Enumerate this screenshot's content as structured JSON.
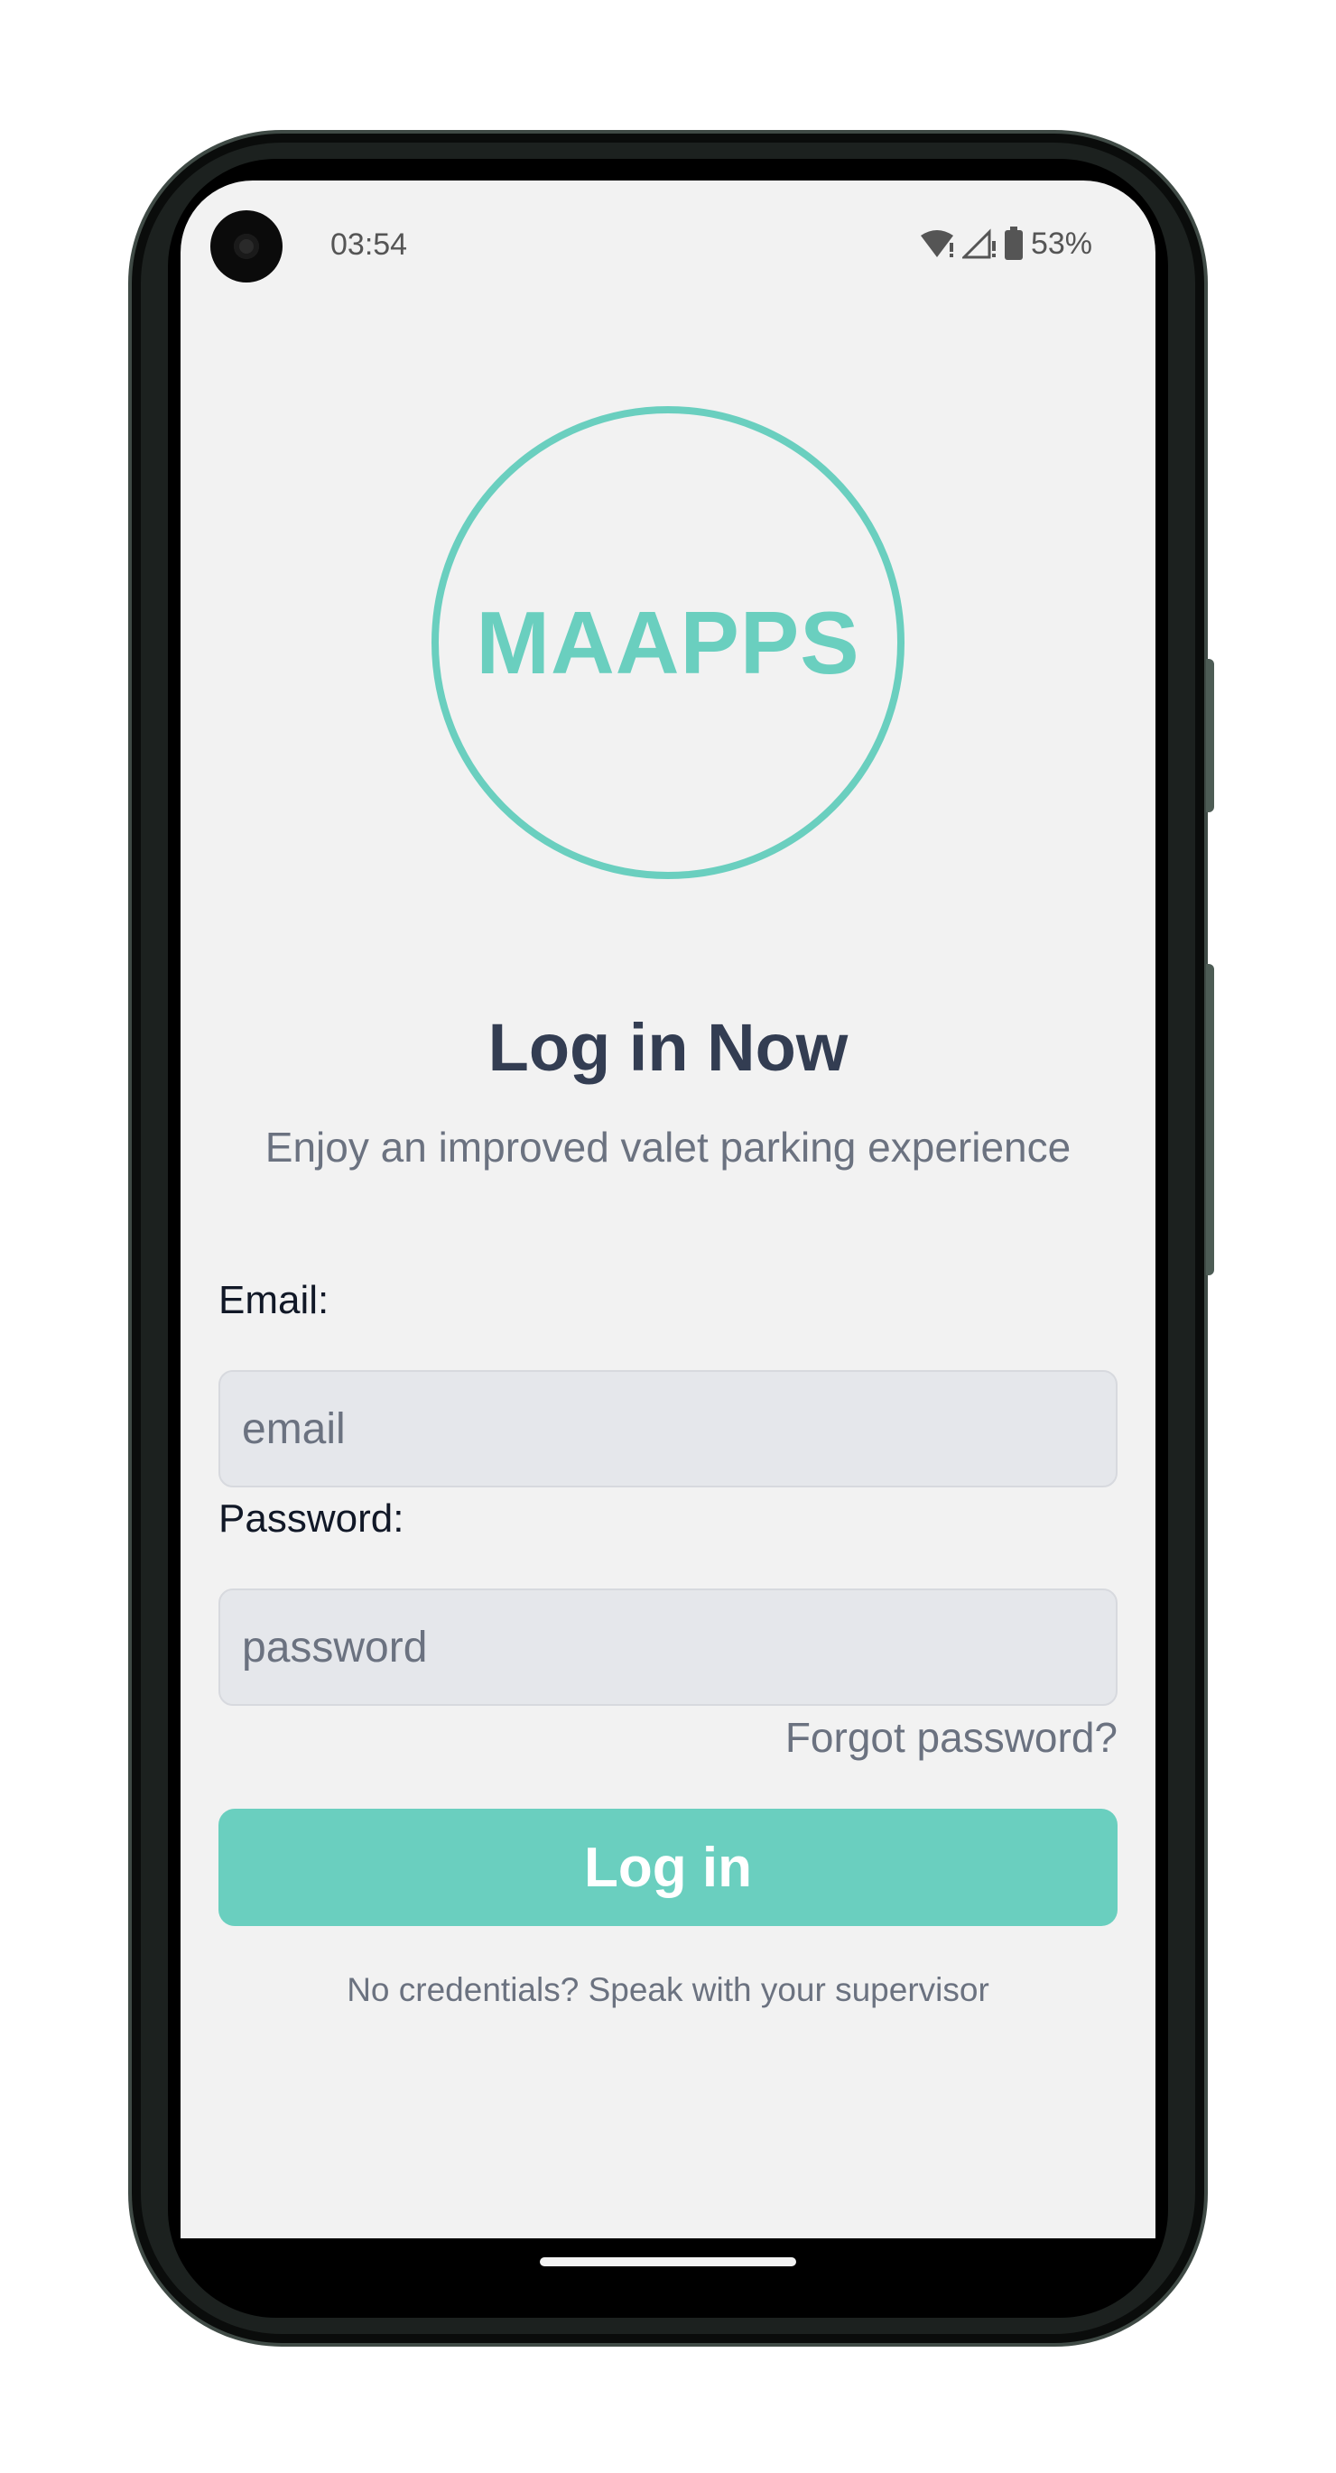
{
  "status_bar": {
    "time": "03:54",
    "battery": "53%",
    "icons": [
      "camera-icon",
      "wifi-icon",
      "signal-icon",
      "battery-icon"
    ]
  },
  "logo": {
    "text": "MAAPPS"
  },
  "header": {
    "title": "Log in Now",
    "subtitle": "Enjoy an improved valet parking experience"
  },
  "form": {
    "email_label": "Email:",
    "email_placeholder": "email",
    "password_label": "Password:",
    "password_placeholder": "password",
    "forgot_link": "Forgot password?",
    "submit_label": "Log in"
  },
  "footer": {
    "note": "No credentials? Speak with your supervisor"
  },
  "colors": {
    "accent": "#6acfbf",
    "title": "#333d52",
    "muted": "#6b7280",
    "background": "#f2f2f2"
  }
}
